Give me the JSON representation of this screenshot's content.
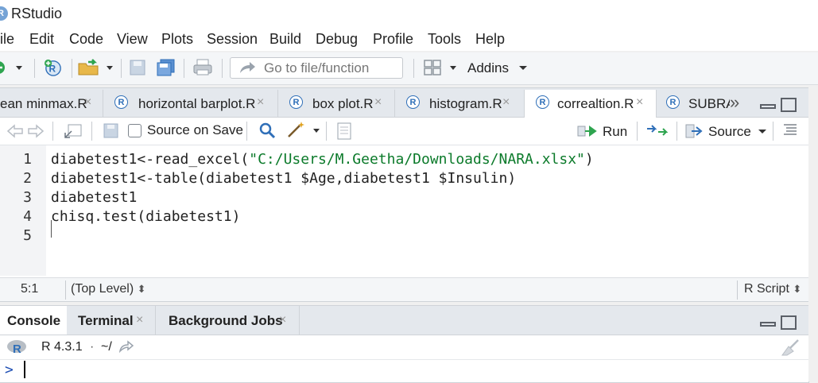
{
  "window": {
    "title": "RStudio",
    "app_icon_letter": "R"
  },
  "menu": [
    "ile",
    "Edit",
    "Code",
    "View",
    "Plots",
    "Session",
    "Build",
    "Debug",
    "Profile",
    "Tools",
    "Help"
  ],
  "toolbar": {
    "goto_placeholder": "Go to file/function",
    "addins_label": "Addins"
  },
  "editor": {
    "tabs": [
      {
        "label": "ean minmax.R",
        "active": false
      },
      {
        "label": "horizontal barplot.R",
        "active": false
      },
      {
        "label": "box plot.R",
        "active": false
      },
      {
        "label": "histogram.R",
        "active": false
      },
      {
        "label": "correaltion.R",
        "active": true
      },
      {
        "label": "SUBRA",
        "active": false
      }
    ],
    "overflow_icon": "»",
    "source_on_save": "Source on Save",
    "run_label": "Run",
    "source_label": "Source",
    "lines": [
      {
        "num": "1",
        "pre": "diabetest1<-read_excel(",
        "str": "\"C:/Users/M.Geetha/Downloads/NARA.xlsx\"",
        "post": ")"
      },
      {
        "num": "2",
        "pre": "diabetest1<-table(diabetest1 $Age,diabetest1 $Insulin)",
        "str": "",
        "post": ""
      },
      {
        "num": "3",
        "pre": "diabetest1",
        "str": "",
        "post": ""
      },
      {
        "num": "4",
        "pre": "chisq.test(diabetest1)",
        "str": "",
        "post": ""
      },
      {
        "num": "5",
        "pre": "",
        "str": "",
        "post": ""
      }
    ],
    "status": {
      "position": "5:1",
      "scope": "(Top Level)",
      "scope_arrow": "⬍",
      "file_type": "R Script",
      "type_arrow": "⬍"
    }
  },
  "console": {
    "tabs": [
      {
        "label": "Console",
        "active": true
      },
      {
        "label": "Terminal",
        "active": false
      },
      {
        "label": "Background Jobs",
        "active": false
      }
    ],
    "version": "R 4.3.1",
    "sep": "·",
    "dir": "~/",
    "prompt": ">"
  }
}
